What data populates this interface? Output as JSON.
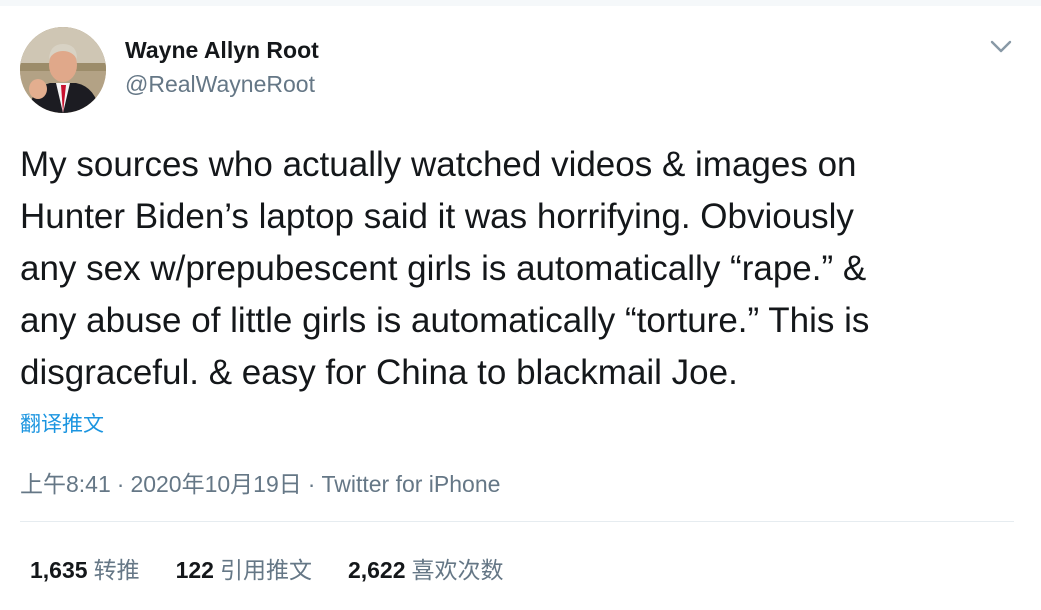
{
  "author": {
    "name": "Wayne Allyn Root",
    "handle": "@RealWayneRoot"
  },
  "tweet": {
    "lines": [
      "My sources who actually watched videos & images on",
      "Hunter Biden’s laptop said it was horrifying. Obviously",
      "any sex w/prepubescent girls is automatically “rape.” &",
      "any abuse of little girls is automatically “torture.” This is",
      "disgraceful. & easy for China to blackmail Joe."
    ],
    "translate_label": "翻译推文",
    "time": "上午8:41",
    "date": "2020年10月19日",
    "separator": "·",
    "source": "Twitter for iPhone"
  },
  "stats": {
    "retweets": {
      "count": "1,635",
      "label": "转推"
    },
    "quotes": {
      "count": "122",
      "label": "引用推文"
    },
    "likes": {
      "count": "2,622",
      "label": "喜欢次数"
    }
  },
  "icons": {
    "menu": "chevron-down-icon"
  },
  "colors": {
    "text": "#14171a",
    "secondary": "#657786",
    "link": "#1b95e0",
    "divider": "#e6ecf0"
  }
}
